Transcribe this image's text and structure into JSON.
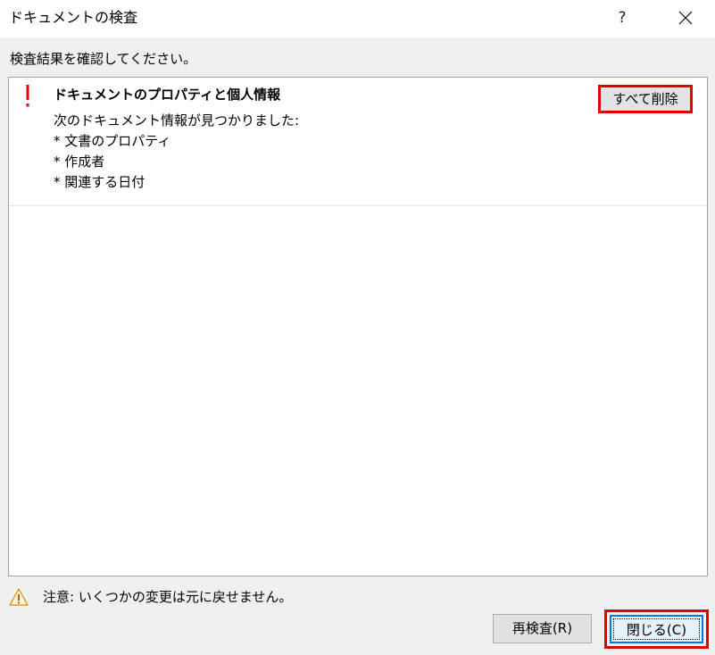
{
  "window": {
    "title": "ドキュメントの検査",
    "help_label": "?",
    "close_icon": "close-icon"
  },
  "instruction": "検査結果を確認してください。",
  "results": [
    {
      "status_icon": "exclamation-icon",
      "status_color": "#e8000b",
      "title": "ドキュメントのプロパティと個人情報",
      "description": [
        "次のドキュメント情報が見つかりました:",
        "* 文書のプロパティ",
        "* 作成者",
        "* 関連する日付"
      ],
      "action_label": "すべて削除"
    }
  ],
  "warning": {
    "icon": "warning-triangle-icon",
    "text": "注意: いくつかの変更は元に戻せません。"
  },
  "buttons": {
    "reinspect_label": "再検査(R)",
    "close_label": "閉じる(C)"
  },
  "colors": {
    "highlight": "#e00000",
    "focus": "#0078d7",
    "warning": "#f0a30a"
  }
}
